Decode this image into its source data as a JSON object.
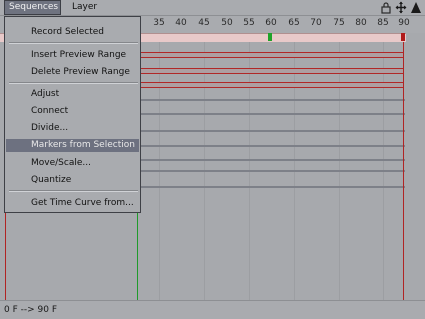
{
  "menubar": {
    "sequences": "Sequences",
    "layer": "Layer"
  },
  "toolbar_icons": [
    "lock-icon",
    "move-icon",
    "triangle-icon"
  ],
  "ruler": {
    "ticks": [
      "35",
      "40",
      "45",
      "50",
      "55",
      "60",
      "65",
      "70",
      "75",
      "80",
      "85",
      "90"
    ]
  },
  "menu": {
    "record_selected": "Record Selected",
    "insert_preview_range": "Insert Preview Range",
    "delete_preview_range": "Delete Preview Range",
    "adjust": "Adjust",
    "connect": "Connect",
    "divide": "Divide...",
    "markers_from_selection": "Markers from Selection",
    "move_scale": "Move/Scale...",
    "quantize": "Quantize",
    "get_time_curve": "Get Time Curve from..."
  },
  "status": {
    "range": "0 F --> 90 F"
  },
  "colors": {
    "selection": "#6d7180",
    "marker_green": "#1fa32a",
    "marker_red": "#b01a1a",
    "track_band": "#e8c9c9"
  }
}
